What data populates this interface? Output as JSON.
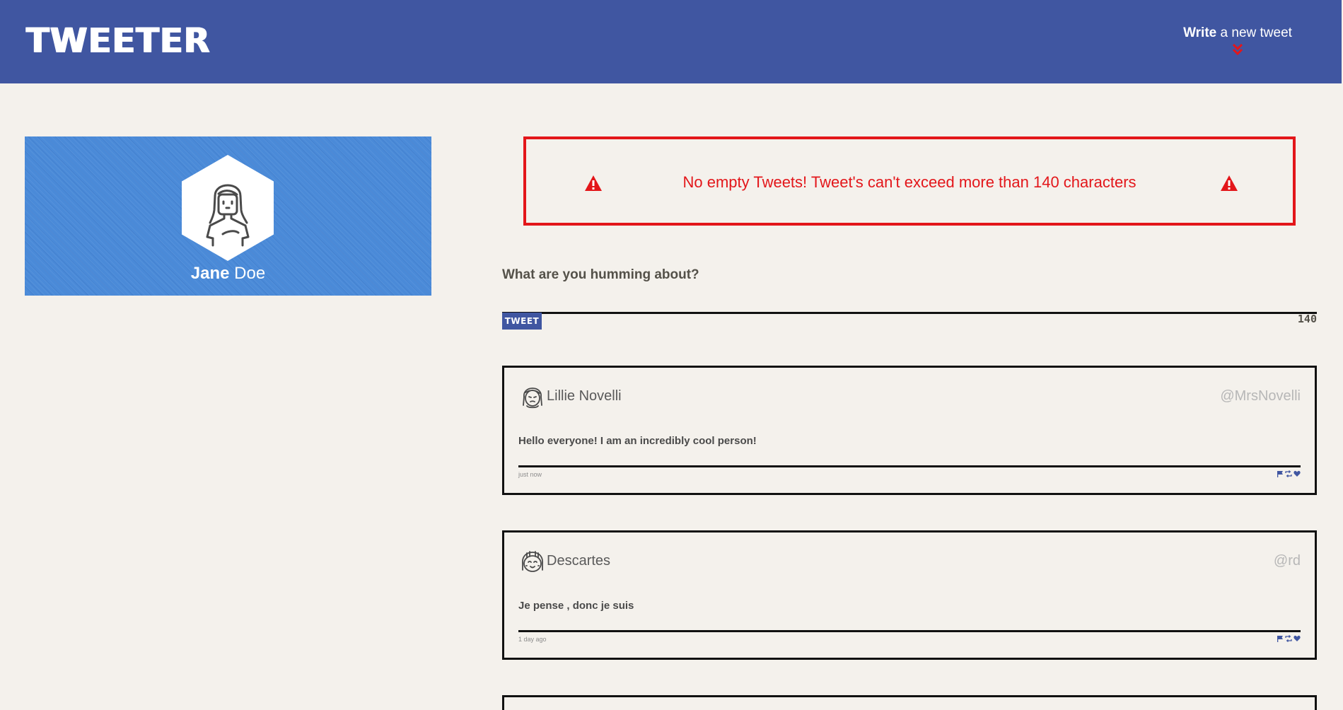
{
  "nav": {
    "brand": "TWEETER",
    "compose_bold": "Write",
    "compose_rest": " a new tweet",
    "chevron_color": "#e3161a",
    "background": "#4056a1"
  },
  "profile": {
    "first_name": "Jane",
    "last_name": " Doe",
    "background": "#4a8ad8"
  },
  "error": {
    "message": "No empty Tweets! Tweet's can't exceed more than 140 characters",
    "color": "#e3161a"
  },
  "composer": {
    "label": "What are you humming about?",
    "input_value": "",
    "submit_label": "TWEET",
    "counter": "140"
  },
  "tweets": [
    {
      "name": "Lillie Novelli",
      "handle": "@MrsNovelli",
      "text": "Hello everyone! I am an incredibly cool person!",
      "time": "just now",
      "avatar_icon": "girl-avatar-icon"
    },
    {
      "name": "Descartes",
      "handle": "@rd",
      "text": "Je pense , donc je suis",
      "time": "1 day ago",
      "avatar_icon": "smiling-avatar-icon"
    }
  ],
  "actions": [
    "flag-icon",
    "retweet-icon",
    "heart-icon"
  ]
}
